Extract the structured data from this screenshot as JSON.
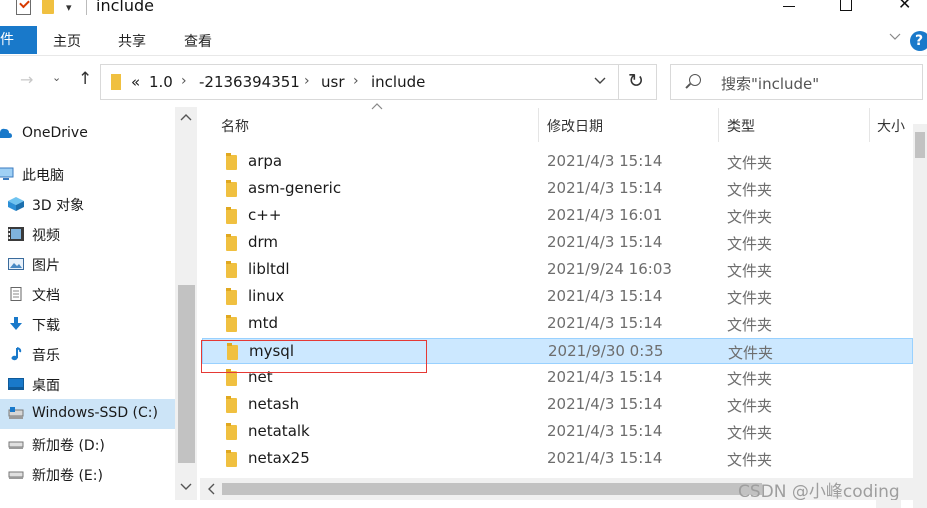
{
  "window": {
    "title": "include"
  },
  "ribbon": {
    "file_tab": "文件",
    "tabs": [
      "主页",
      "共享",
      "查看"
    ],
    "help": "?"
  },
  "address": {
    "overflow": "«",
    "segments": [
      "1.0",
      "-2136394351",
      "usr",
      "include"
    ]
  },
  "search": {
    "placeholder": "搜索\"include\""
  },
  "nav": {
    "items": [
      {
        "label": "OneDrive",
        "icon": "cloud-icon"
      },
      {
        "label": "此电脑",
        "icon": "computer-icon"
      },
      {
        "label": "3D 对象",
        "icon": "3d-objects-icon"
      },
      {
        "label": "视频",
        "icon": "video-icon"
      },
      {
        "label": "图片",
        "icon": "pictures-icon"
      },
      {
        "label": "文档",
        "icon": "documents-icon"
      },
      {
        "label": "下载",
        "icon": "download-icon"
      },
      {
        "label": "音乐",
        "icon": "music-icon"
      },
      {
        "label": "桌面",
        "icon": "desktop-icon"
      },
      {
        "label": "Windows-SSD (C:)",
        "icon": "drive-icon"
      },
      {
        "label": "新加卷 (D:)",
        "icon": "drive-icon"
      },
      {
        "label": "新加卷 (E:)",
        "icon": "drive-icon"
      }
    ]
  },
  "columns": {
    "name": "名称",
    "modified": "修改日期",
    "type": "类型",
    "size": "大小"
  },
  "files": [
    {
      "name": "arpa",
      "modified": "2021/4/3 15:14",
      "type": "文件夹"
    },
    {
      "name": "asm-generic",
      "modified": "2021/4/3 15:14",
      "type": "文件夹"
    },
    {
      "name": "c++",
      "modified": "2021/4/3 16:01",
      "type": "文件夹"
    },
    {
      "name": "drm",
      "modified": "2021/4/3 15:14",
      "type": "文件夹"
    },
    {
      "name": "libltdl",
      "modified": "2021/9/24 16:03",
      "type": "文件夹"
    },
    {
      "name": "linux",
      "modified": "2021/4/3 15:14",
      "type": "文件夹"
    },
    {
      "name": "mtd",
      "modified": "2021/4/3 15:14",
      "type": "文件夹"
    },
    {
      "name": "mysql",
      "modified": "2021/9/30 0:35",
      "type": "文件夹"
    },
    {
      "name": "net",
      "modified": "2021/4/3 15:14",
      "type": "文件夹"
    },
    {
      "name": "netash",
      "modified": "2021/4/3 15:14",
      "type": "文件夹"
    },
    {
      "name": "netatalk",
      "modified": "2021/4/3 15:14",
      "type": "文件夹"
    },
    {
      "name": "netax25",
      "modified": "2021/4/3 15:14",
      "type": "文件夹"
    }
  ],
  "watermark": "CSDN @小峰coding",
  "colors": {
    "accent": "#1979ca",
    "selection": "#cce8ff",
    "folder": "#f0c040",
    "highlight_box": "#e53935"
  }
}
